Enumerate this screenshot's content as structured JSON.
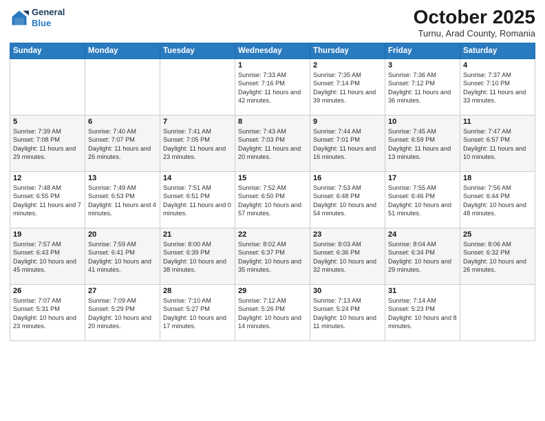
{
  "header": {
    "logo_line1": "General",
    "logo_line2": "Blue",
    "month": "October 2025",
    "location": "Turnu, Arad County, Romania"
  },
  "weekdays": [
    "Sunday",
    "Monday",
    "Tuesday",
    "Wednesday",
    "Thursday",
    "Friday",
    "Saturday"
  ],
  "weeks": [
    [
      {
        "day": "",
        "info": ""
      },
      {
        "day": "",
        "info": ""
      },
      {
        "day": "",
        "info": ""
      },
      {
        "day": "1",
        "info": "Sunrise: 7:33 AM\nSunset: 7:16 PM\nDaylight: 11 hours\nand 42 minutes."
      },
      {
        "day": "2",
        "info": "Sunrise: 7:35 AM\nSunset: 7:14 PM\nDaylight: 11 hours\nand 39 minutes."
      },
      {
        "day": "3",
        "info": "Sunrise: 7:36 AM\nSunset: 7:12 PM\nDaylight: 11 hours\nand 36 minutes."
      },
      {
        "day": "4",
        "info": "Sunrise: 7:37 AM\nSunset: 7:10 PM\nDaylight: 11 hours\nand 33 minutes."
      }
    ],
    [
      {
        "day": "5",
        "info": "Sunrise: 7:39 AM\nSunset: 7:08 PM\nDaylight: 11 hours\nand 29 minutes."
      },
      {
        "day": "6",
        "info": "Sunrise: 7:40 AM\nSunset: 7:07 PM\nDaylight: 11 hours\nand 26 minutes."
      },
      {
        "day": "7",
        "info": "Sunrise: 7:41 AM\nSunset: 7:05 PM\nDaylight: 11 hours\nand 23 minutes."
      },
      {
        "day": "8",
        "info": "Sunrise: 7:43 AM\nSunset: 7:03 PM\nDaylight: 11 hours\nand 20 minutes."
      },
      {
        "day": "9",
        "info": "Sunrise: 7:44 AM\nSunset: 7:01 PM\nDaylight: 11 hours\nand 16 minutes."
      },
      {
        "day": "10",
        "info": "Sunrise: 7:45 AM\nSunset: 6:59 PM\nDaylight: 11 hours\nand 13 minutes."
      },
      {
        "day": "11",
        "info": "Sunrise: 7:47 AM\nSunset: 6:57 PM\nDaylight: 11 hours\nand 10 minutes."
      }
    ],
    [
      {
        "day": "12",
        "info": "Sunrise: 7:48 AM\nSunset: 6:55 PM\nDaylight: 11 hours\nand 7 minutes."
      },
      {
        "day": "13",
        "info": "Sunrise: 7:49 AM\nSunset: 6:53 PM\nDaylight: 11 hours\nand 4 minutes."
      },
      {
        "day": "14",
        "info": "Sunrise: 7:51 AM\nSunset: 6:51 PM\nDaylight: 11 hours\nand 0 minutes."
      },
      {
        "day": "15",
        "info": "Sunrise: 7:52 AM\nSunset: 6:50 PM\nDaylight: 10 hours\nand 57 minutes."
      },
      {
        "day": "16",
        "info": "Sunrise: 7:53 AM\nSunset: 6:48 PM\nDaylight: 10 hours\nand 54 minutes."
      },
      {
        "day": "17",
        "info": "Sunrise: 7:55 AM\nSunset: 6:46 PM\nDaylight: 10 hours\nand 51 minutes."
      },
      {
        "day": "18",
        "info": "Sunrise: 7:56 AM\nSunset: 6:44 PM\nDaylight: 10 hours\nand 48 minutes."
      }
    ],
    [
      {
        "day": "19",
        "info": "Sunrise: 7:57 AM\nSunset: 6:43 PM\nDaylight: 10 hours\nand 45 minutes."
      },
      {
        "day": "20",
        "info": "Sunrise: 7:59 AM\nSunset: 6:41 PM\nDaylight: 10 hours\nand 41 minutes."
      },
      {
        "day": "21",
        "info": "Sunrise: 8:00 AM\nSunset: 6:39 PM\nDaylight: 10 hours\nand 38 minutes."
      },
      {
        "day": "22",
        "info": "Sunrise: 8:02 AM\nSunset: 6:37 PM\nDaylight: 10 hours\nand 35 minutes."
      },
      {
        "day": "23",
        "info": "Sunrise: 8:03 AM\nSunset: 6:36 PM\nDaylight: 10 hours\nand 32 minutes."
      },
      {
        "day": "24",
        "info": "Sunrise: 8:04 AM\nSunset: 6:34 PM\nDaylight: 10 hours\nand 29 minutes."
      },
      {
        "day": "25",
        "info": "Sunrise: 8:06 AM\nSunset: 6:32 PM\nDaylight: 10 hours\nand 26 minutes."
      }
    ],
    [
      {
        "day": "26",
        "info": "Sunrise: 7:07 AM\nSunset: 5:31 PM\nDaylight: 10 hours\nand 23 minutes."
      },
      {
        "day": "27",
        "info": "Sunrise: 7:09 AM\nSunset: 5:29 PM\nDaylight: 10 hours\nand 20 minutes."
      },
      {
        "day": "28",
        "info": "Sunrise: 7:10 AM\nSunset: 5:27 PM\nDaylight: 10 hours\nand 17 minutes."
      },
      {
        "day": "29",
        "info": "Sunrise: 7:12 AM\nSunset: 5:26 PM\nDaylight: 10 hours\nand 14 minutes."
      },
      {
        "day": "30",
        "info": "Sunrise: 7:13 AM\nSunset: 5:24 PM\nDaylight: 10 hours\nand 11 minutes."
      },
      {
        "day": "31",
        "info": "Sunrise: 7:14 AM\nSunset: 5:23 PM\nDaylight: 10 hours\nand 8 minutes."
      },
      {
        "day": "",
        "info": ""
      }
    ]
  ]
}
